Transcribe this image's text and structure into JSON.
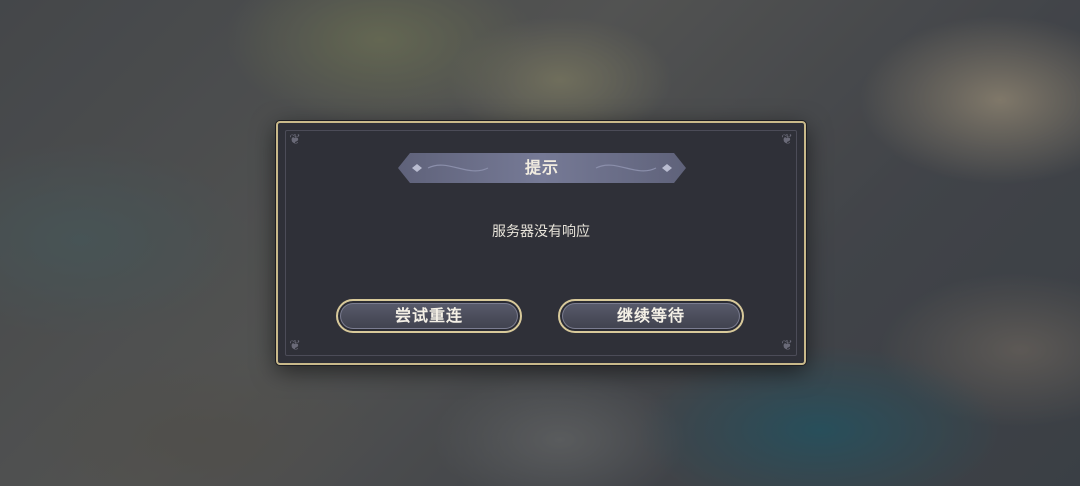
{
  "dialog": {
    "title": "提示",
    "message": "服务器没有响应",
    "buttons": {
      "retry": "尝试重连",
      "wait": "继续等待"
    }
  },
  "colors": {
    "border": "#c9b98a",
    "panel": "#2f3038",
    "title_band": "#6b6e88",
    "button_fill": "#4a4c5a"
  },
  "icons": [
    "ornament-corner-icon",
    "diamond-ornament-icon"
  ]
}
